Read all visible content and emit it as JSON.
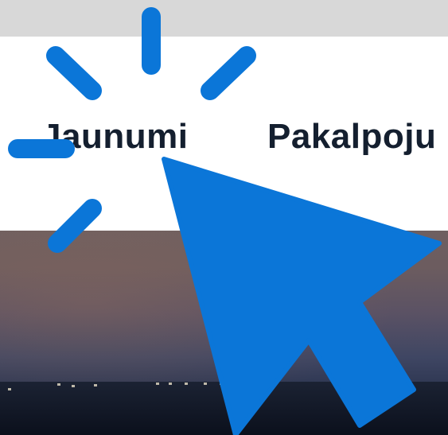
{
  "nav": {
    "news_label": "Jaunumi",
    "services_label": "Pakalpoju"
  },
  "overlay": {
    "cursor_icon": "mouse-pointer-icon",
    "click_icon": "click-burst-icon",
    "cursor_color": "#0b76d8"
  }
}
